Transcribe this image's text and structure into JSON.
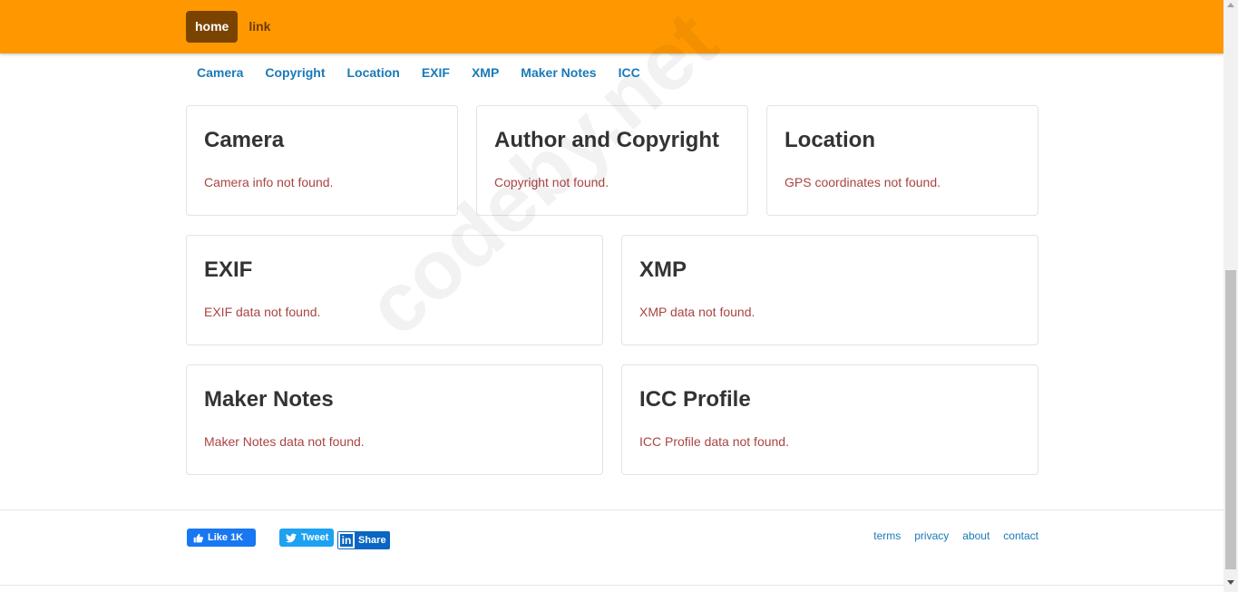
{
  "navbar": {
    "home_label": "home",
    "link_label": "link",
    "background_color": "#ff9800"
  },
  "subnav": {
    "items": [
      "Camera",
      "Copyright",
      "Location",
      "EXIF",
      "XMP",
      "Maker Notes",
      "ICC"
    ]
  },
  "cards": {
    "camera": {
      "title": "Camera",
      "message": "Camera info not found."
    },
    "copyright": {
      "title": "Author and Copyright",
      "message": "Copyright not found."
    },
    "location": {
      "title": "Location",
      "message": "GPS coordinates not found."
    },
    "exif": {
      "title": "EXIF",
      "message": "EXIF data not found."
    },
    "xmp": {
      "title": "XMP",
      "message": "XMP data not found."
    },
    "maker_notes": {
      "title": "Maker Notes",
      "message": "Maker Notes data not found."
    },
    "icc": {
      "title": "ICC Profile",
      "message": "ICC Profile data not found."
    }
  },
  "footer": {
    "like_label": "Like 1K",
    "tweet_label": "Tweet",
    "share_label": "Share",
    "links": [
      "terms",
      "privacy",
      "about",
      "contact"
    ]
  },
  "watermark": "codeby.net",
  "icons": {
    "like": "thumbs-up-icon",
    "tweet": "twitter-bird-icon",
    "share": "linkedin-icon"
  }
}
